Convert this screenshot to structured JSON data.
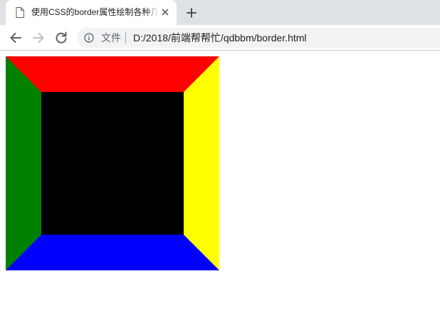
{
  "browser": {
    "tab": {
      "title": "使用CSS的border属性绘制各种几何图形",
      "icon": "document-icon",
      "close_icon": "close-icon"
    },
    "new_tab_icon": "plus-icon",
    "toolbar": {
      "back_icon": "arrow-left-icon",
      "forward_icon": "arrow-right-icon",
      "reload_icon": "reload-icon",
      "info_icon": "info-icon",
      "scheme_label": "文件",
      "url": "D:/2018/前端帮帮忙/qdbbm/border.html"
    },
    "colors": {
      "tabstrip": "#dee1e6",
      "omnibox": "#f1f3f4"
    }
  },
  "page": {
    "box": {
      "border_top_color": "#ff0000",
      "border_right_color": "#ffff00",
      "border_bottom_color": "#0000ff",
      "border_left_color": "#008000",
      "background_color": "#000000"
    }
  }
}
